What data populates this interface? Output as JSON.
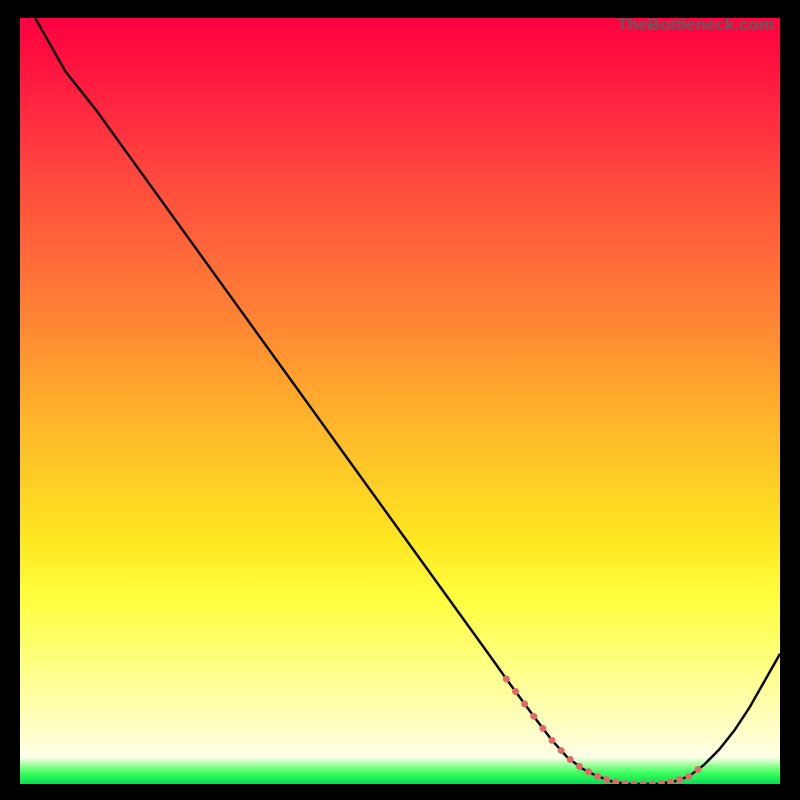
{
  "watermark": "TheBottleneck.com",
  "chart_data": {
    "type": "line",
    "title": "",
    "xlabel": "",
    "ylabel": "",
    "xlim": [
      0,
      100
    ],
    "ylim": [
      0,
      100
    ],
    "series": [
      {
        "name": "curve",
        "x": [
          2,
          6,
          10,
          14,
          18,
          22,
          26,
          30,
          34,
          38,
          42,
          46,
          50,
          54,
          58,
          62,
          64,
          66,
          68,
          70,
          72,
          74,
          76,
          78,
          80,
          82,
          84,
          86,
          88,
          90,
          92,
          94,
          96,
          98,
          100
        ],
        "y": [
          100,
          93,
          88,
          82.5,
          77,
          71.5,
          66,
          60.5,
          55,
          49.5,
          44,
          38.5,
          33,
          27.5,
          22,
          16.5,
          13.7,
          11,
          8.3,
          5.7,
          3.5,
          2,
          1,
          0.3,
          0,
          0,
          0,
          0.3,
          1,
          2.5,
          4.5,
          7,
          10,
          13.5,
          17
        ]
      }
    ],
    "dotted_segment": {
      "x_start": 64,
      "x_end": 90
    },
    "colors": {
      "curve": "#0a0a0a",
      "dots": "#e06a6a"
    }
  }
}
